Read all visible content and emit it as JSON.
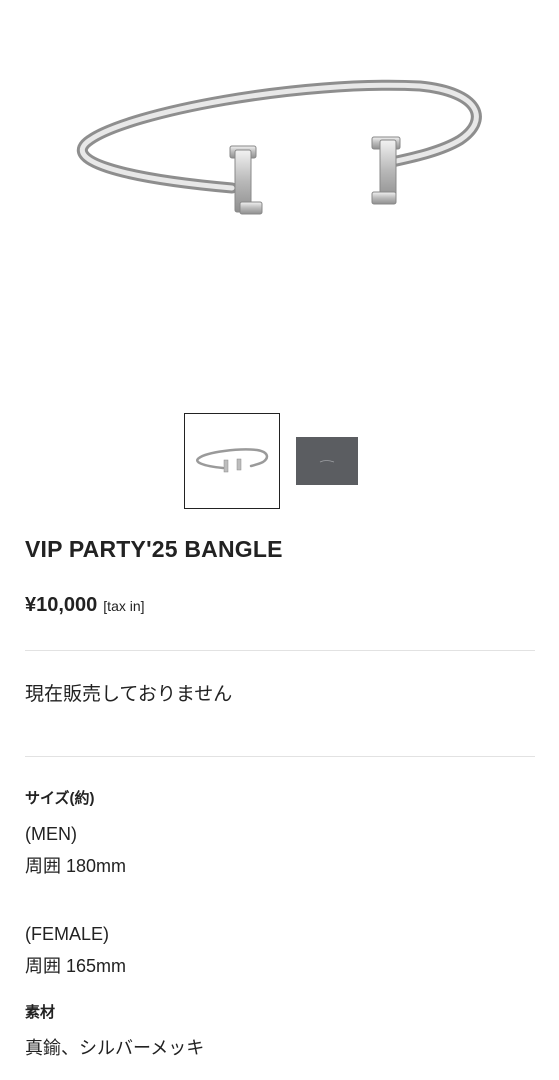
{
  "product": {
    "title": "VIP PARTY'25 BANGLE",
    "price": "¥10,000",
    "tax_note": "[tax in]",
    "status": "現在販売しておりません"
  },
  "gallery": {
    "thumbnails": [
      {
        "label": "bangle-photo",
        "selected": true
      },
      {
        "label": "box-photo",
        "selected": false
      }
    ],
    "box_color": "#5b5d61"
  },
  "spec": {
    "size_heading": "サイズ(約)",
    "men_label": "(MEN)",
    "men_value": "周囲 180mm",
    "female_label": "(FEMALE)",
    "female_value": "周囲 165mm",
    "material_heading": "素材",
    "material_value": "真鍮、シルバーメッキ"
  }
}
